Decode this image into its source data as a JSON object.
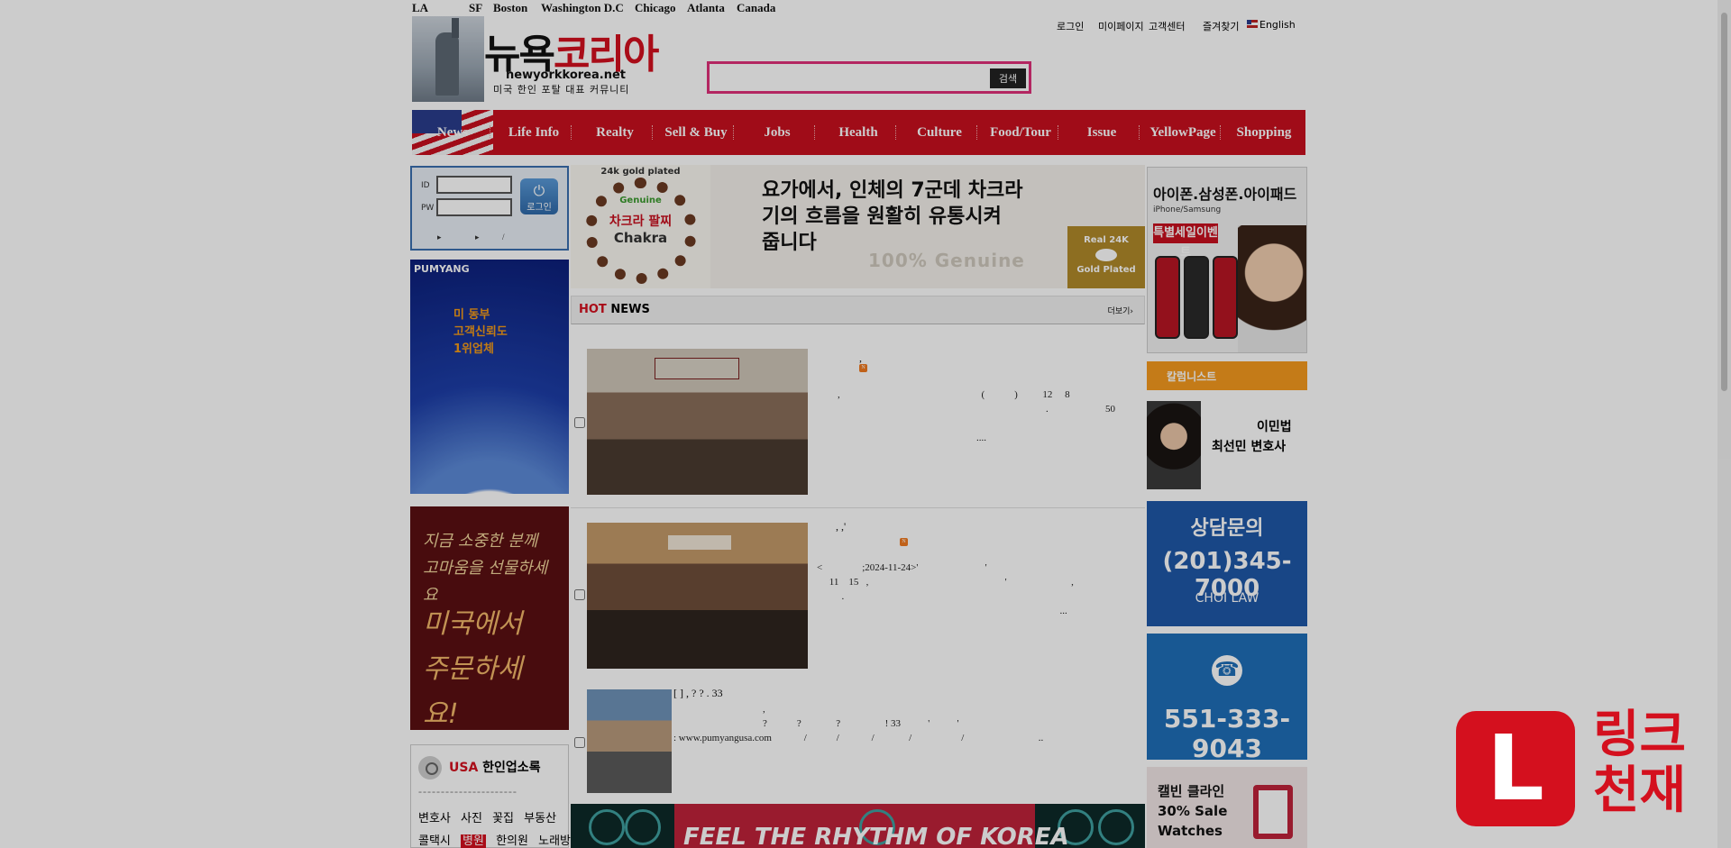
{
  "cities": [
    "LA",
    "SF",
    "Boston",
    "Washington D.C",
    "Chicago",
    "Atlanta",
    "Canada"
  ],
  "logo": {
    "title_black": "뉴욕",
    "title_red": "코리아",
    "url": "newyorkkorea.net",
    "tagline": "미국 한인 포탈 대표 커뮤니티"
  },
  "search": {
    "button": "검색",
    "placeholder": ""
  },
  "toplinks": {
    "login": "로그인",
    "mypage": "미이페이지",
    "support": "고객센터",
    "favorites": "즐겨찾기",
    "english": "English"
  },
  "nav": [
    "News",
    "Life Info",
    "Realty",
    "Sell & Buy",
    "Jobs",
    "Health",
    "Culture",
    "Food/Tour",
    "Issue",
    "YellowPage",
    "Shopping"
  ],
  "login": {
    "id_label": "ID",
    "pw_label": "PW",
    "button": "로그인",
    "link1": "▸",
    "link2": "▸",
    "link3": "/"
  },
  "ad_pumyang": {
    "brand": "PUMYANG",
    "line1": "미 동부",
    "line2": "고객신뢰도",
    "line3": "1위업체"
  },
  "ad_gift": {
    "line1": "지금 소중한 분께",
    "line2": "고마움을 선물하세요",
    "line3": "미국에서",
    "line4": "주문하세요!"
  },
  "directory": {
    "title_usa": "USA",
    "title_rest": "한인업소록",
    "dashes": "----------------------",
    "row1": [
      "변호사",
      "사진",
      "꽃집",
      "부동산"
    ],
    "row2_a": "콜택시",
    "row2_hot": "병원",
    "row2_b": "한의원",
    "row2_c": "노래방"
  },
  "ad_chakra": {
    "gold": "24k gold plated",
    "genuine": "Genuine",
    "kr": "차크라 팔찌",
    "en": "Chakra",
    "headline1": "요가에서, 인체의 7군데 차크라",
    "headline2": "기의 흐름을 원활히 유통시켜",
    "headline3": "줍니다",
    "genuine_big": "100% Genuine",
    "badge1": "Real 24K",
    "badge2": "Gold Plated"
  },
  "hotnews": {
    "hot": "HOT",
    "news": " NEWS",
    "more": "더보기›"
  },
  "news_items": [
    {
      "title": ",",
      "badge": "N",
      "body": ",                                                         (            )          12     8\n                                                                                    .                       50\n                                                                                                                                         .\n                                                        ...."
    },
    {
      "title": ",        ,'",
      "badge": "N",
      "body": "<                ;2024-11-24>'                           '\n     11    15   ,                                                       '                          ,\n          .\n                                                                                                  ..."
    },
    {
      "title": "[                ]           ,            ?             ?                  . 33",
      "body": "                                    ,\n                                    ?            ?              ?                  ! 33           '           '\n: www.pumyangusa.com             /            /             /              /                    /                              .."
    }
  ],
  "ad_korea": {
    "text": "FEEL THE RHYTHM OF KOREA"
  },
  "ad_phone": {
    "line1": "아이폰.삼성폰.아이패드",
    "line2": "iPhone/Samsung",
    "line3": "특별세일이벤트"
  },
  "columnist": {
    "header": "칼럼니스트",
    "name1": "이민법",
    "name2": "최선민 변호사"
  },
  "ad_choi": {
    "line1": "상담문의",
    "line2": "(201)345-7000",
    "line3": "CHOI LAW"
  },
  "ad_phone2": {
    "icon": "☎",
    "number": "551-333-9043"
  },
  "ad_calvin": {
    "line1": "캘빈 클라인",
    "line2": "30% Sale",
    "line3": "Watches"
  },
  "watermark": {
    "letter": "L",
    "line1": "링크",
    "line2": "천재"
  }
}
